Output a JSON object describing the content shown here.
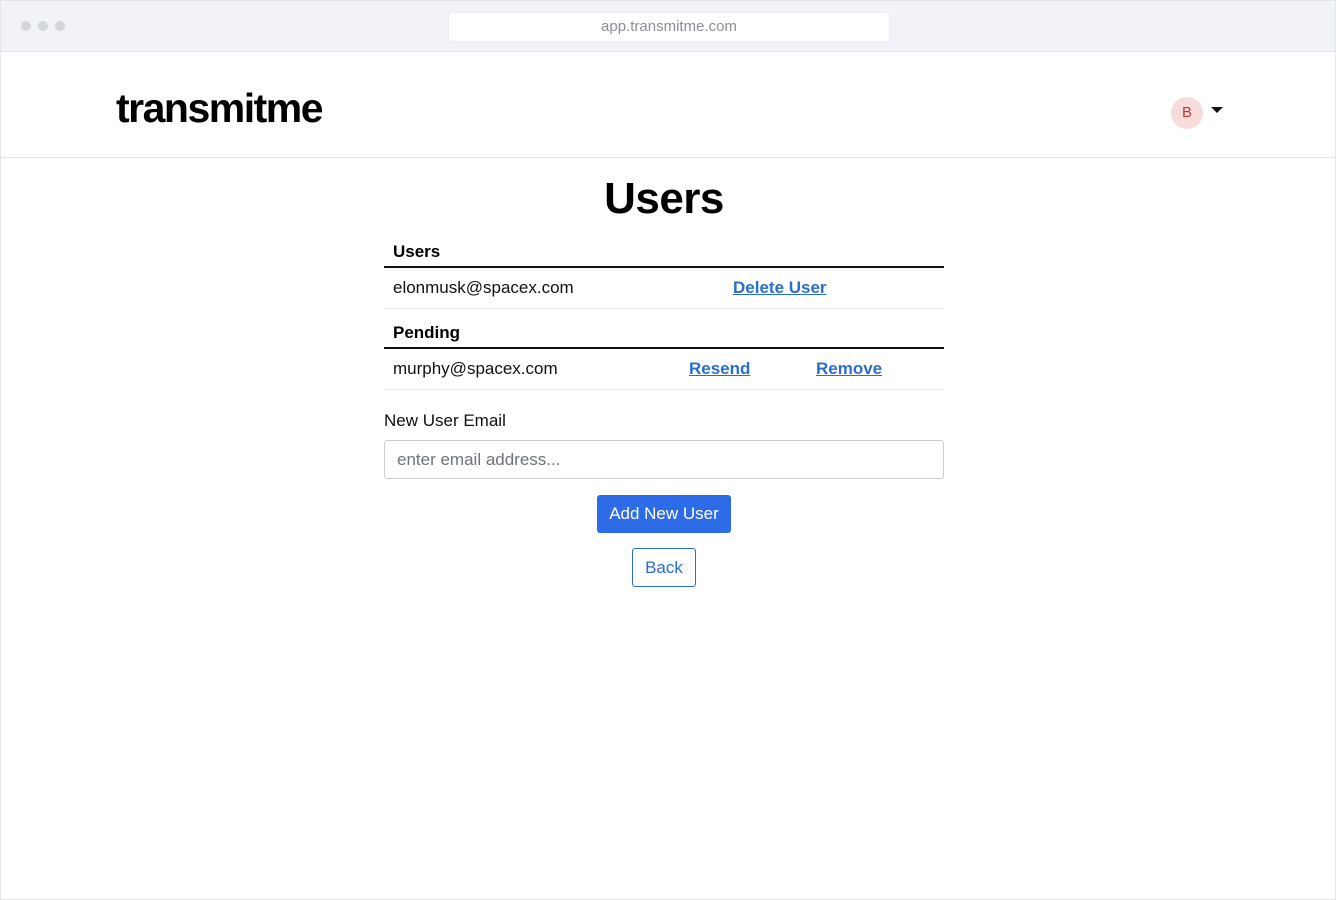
{
  "browser": {
    "url": "app.transmitme.com"
  },
  "header": {
    "logo": "transmitme",
    "avatar_initial": "B",
    "avatar_color": "#f8dcdc",
    "dropdown_icon": "caret-down-icon"
  },
  "page": {
    "title": "Users"
  },
  "users_section": {
    "heading": "Users",
    "rows": [
      {
        "email": "elonmusk@spacex.com",
        "delete_label": "Delete User"
      }
    ]
  },
  "pending_section": {
    "heading": "Pending",
    "rows": [
      {
        "email": "murphy@spacex.com",
        "resend_label": "Resend",
        "remove_label": "Remove"
      }
    ]
  },
  "new_user": {
    "label": "New User Email",
    "value": "",
    "placeholder": "enter email address...",
    "add_button": "Add New User",
    "back_button": "Back"
  },
  "colors": {
    "primary": "#2e6be6",
    "link": "#2a6ecf"
  }
}
